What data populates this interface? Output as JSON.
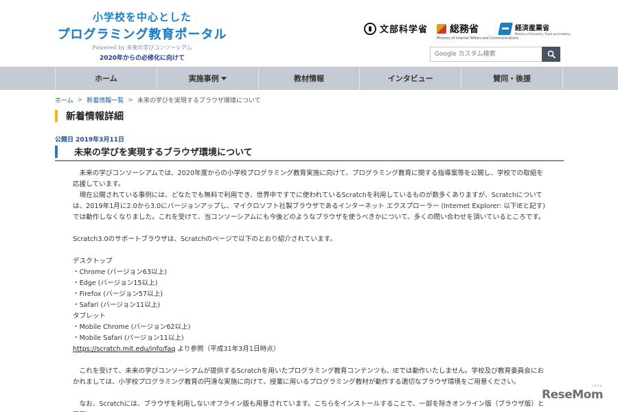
{
  "logo": {
    "line1": "小学校を中心とした",
    "line2": "プログラミング教育ポータル",
    "powered": "Powered by 未来の学びコンソーシアム",
    "tagline": "2020年からの必修化に向けて"
  },
  "ministries": {
    "mext": "文部科学省",
    "mic": "総務省",
    "mic_sub": "Ministry of Internal Affairs and Communications",
    "meti": "経済産業省",
    "meti_sub": "Ministry of Economy, Trade and Industry"
  },
  "search": {
    "placeholder": "Google カスタム検索",
    "button_icon": "search-icon"
  },
  "nav": {
    "items": [
      {
        "label": "ホーム"
      },
      {
        "label": "実施事例"
      },
      {
        "label": "教材情報"
      },
      {
        "label": "インタビュー"
      },
      {
        "label": "賛同・後援"
      }
    ]
  },
  "breadcrumb": {
    "home": "ホーム",
    "news": "新着情報一覧",
    "current": "未来の学びを実現するブラウザ環境について",
    "sep": ">"
  },
  "section": {
    "title": "新着情報詳細"
  },
  "article": {
    "pubdate": "公開日 2019年3月11日",
    "title": "未来の学びを実現するブラウザ環境について",
    "p1": "　未来の学びコンソーシアムでは、2020年度からの小学校プログラミング教育実施に向けて、プログラミング教育に関する指導案等を公開し、学校での取組を応援しています。",
    "p2": "　現在公開されている事例には、どなたでも無料で利用でき、世界中ですでに使われているScratchを利用しているものが数多くありますが、Scratchについては、2019年1月に2.0から3.0にバージョンアップし、マイクロソフト社製ブラウザであるインターネット エクスプローラー (Internet Explorer: 以下IEと記す)では動作しなくなりました。これを受けて、当コンソーシアムにも今後どのようなブラウザを使うべきかについて、多くの問い合わせを頂いているところです。",
    "p3": "Scratch3.0のサポートブラウザは、Scratchのページで以下のとおり紹介されています。",
    "desktop": "デスクトップ",
    "d1": "・Chrome (バージョン63以上)",
    "d2": "・Edge (バージョン15以上)",
    "d3": "・Firefox (バージョン57以上)",
    "d4": "・Safari (バージョン11以上)",
    "tablet": "タブレット",
    "t1": "・Mobile Chrome (バージョン62以上)",
    "t2": "・Mobile Safari (バージョン11以上)",
    "link": "https://scratch.mit.edu/info/faq",
    "link_suffix": " より参照（平成31年3月1日時点）",
    "p4": "　これを受けて、未来の学びコンソーシアムが提供するScratchを用いたプログラミング教育コンテンツも、IEでは動作いたしません。学校及び教育委員会におかれましては、小学校プログラミング教育の円滑な実施に向けて、授業に用いるプログラミング教材が動作する適切なブラウザ環境をご用意ください。",
    "p5": "　なお、Scratchには、ブラウザを利用しないオフライン版も用意されています。こちらをインストールすることで、一部を除きオンライン版（ブラウザ版）と同等"
  },
  "watermark": {
    "text": "ReseMom",
    "sub": "リセマム"
  }
}
